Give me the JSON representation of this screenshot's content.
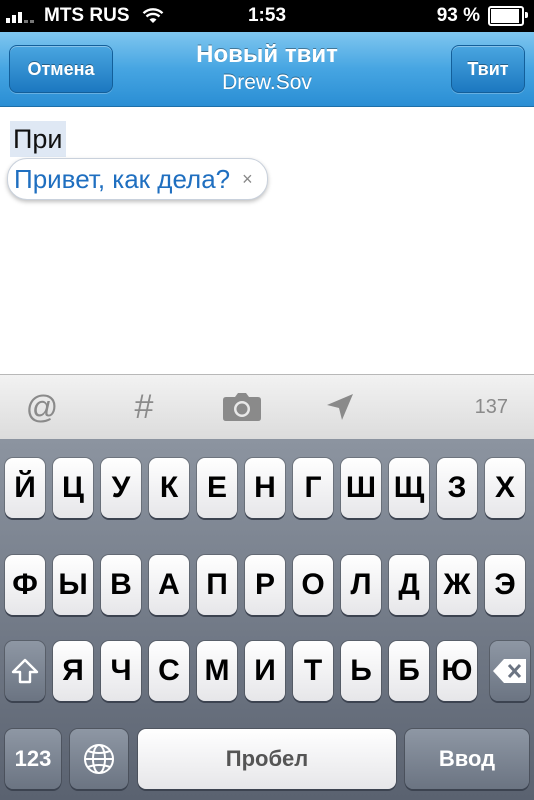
{
  "status_bar": {
    "carrier": "MTS RUS",
    "time": "1:53",
    "battery": "93 %",
    "battery_level": 0.93
  },
  "nav": {
    "cancel_label": "Отмена",
    "title": "Новый твит",
    "subtitle": "Drew.Sov",
    "tweet_label": "Твит"
  },
  "compose": {
    "typed_text": "При",
    "suggestion": "Привет, как дела?",
    "suggestion_close": "×"
  },
  "toolbar": {
    "mention_icon": "@",
    "hashtag_icon": "#",
    "camera_icon": "camera-icon",
    "location_icon": "location-arrow-icon",
    "char_count": "137"
  },
  "keyboard": {
    "row1": [
      "Й",
      "Ц",
      "У",
      "К",
      "Е",
      "Н",
      "Г",
      "Ш",
      "Щ",
      "З",
      "Х"
    ],
    "row2": [
      "Ф",
      "Ы",
      "В",
      "А",
      "П",
      "Р",
      "О",
      "Л",
      "Д",
      "Ж",
      "Э"
    ],
    "row3": [
      "Я",
      "Ч",
      "С",
      "М",
      "И",
      "Т",
      "Ь",
      "Б",
      "Ю"
    ],
    "shift_icon": "shift-icon",
    "delete_icon": "delete-icon",
    "numbers_label": "123",
    "globe_icon": "globe-icon",
    "space_label": "Пробел",
    "return_label": "Ввод"
  },
  "colors": {
    "nav_blue": "#2a8ed4",
    "suggestion_text": "#1f6fc0"
  }
}
